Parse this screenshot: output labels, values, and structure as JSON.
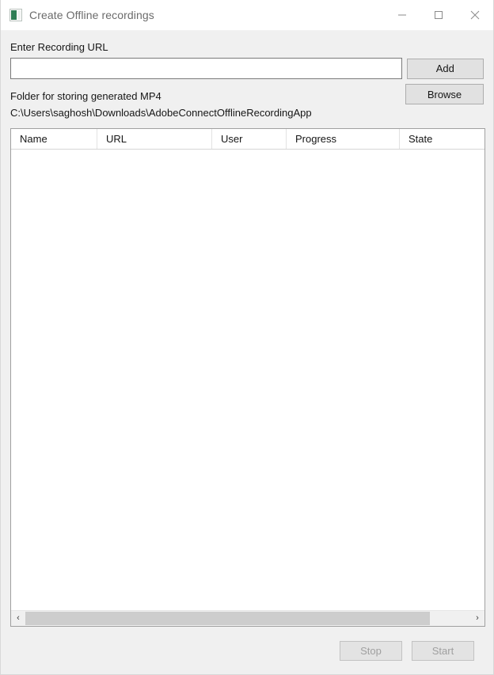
{
  "window": {
    "title": "Create Offline recordings",
    "icon": "app-window-icon",
    "controls": {
      "minimize": "minimize-icon",
      "maximize": "maximize-icon",
      "close": "close-icon"
    }
  },
  "form": {
    "url_label": "Enter Recording URL",
    "url_value": "",
    "url_placeholder": "",
    "add_label": "Add",
    "folder_label": "Folder for storing generated MP4",
    "folder_path": "C:\\Users\\saghosh\\Downloads\\AdobeConnectOfflineRecordingApp",
    "browse_label": "Browse"
  },
  "table": {
    "columns": [
      {
        "label": "Name"
      },
      {
        "label": "URL"
      },
      {
        "label": "User"
      },
      {
        "label": "Progress"
      },
      {
        "label": "State"
      }
    ],
    "rows": []
  },
  "scrollbar": {
    "left_arrow": "‹",
    "right_arrow": "›"
  },
  "footer": {
    "stop_label": "Stop",
    "start_label": "Start",
    "stop_enabled": false,
    "start_enabled": false
  },
  "colors": {
    "accent_icon_green": "#2e7d54",
    "window_bg": "#f0f0f0",
    "titlebar_bg": "#ffffff",
    "field_bg": "#ffffff",
    "button_bg": "#e1e1e1",
    "disabled_text": "#a0a0a0",
    "scroll_thumb": "#cdcdcd"
  }
}
